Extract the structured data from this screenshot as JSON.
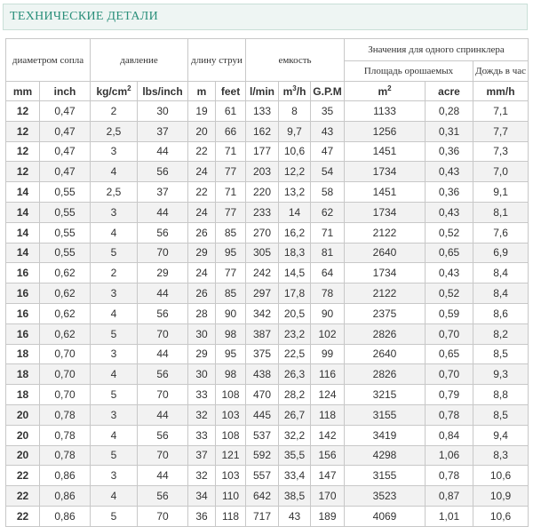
{
  "title": "ТЕХНИЧЕСКИЕ ДЕТАЛИ",
  "groups": {
    "nozzle": "диаметром сопла",
    "pressure": "давление",
    "jet": "длину струи",
    "capacity": "емкость",
    "per_sprinkler": "Значения для одного спринклера",
    "area": "Площадь орошаемых",
    "rain": "Дождь в час"
  },
  "units": [
    "mm",
    "inch",
    "kg/cm",
    "lbs/inch",
    "m",
    "feet",
    "l/min",
    "m",
    "G.P.M",
    "m",
    "acre",
    "mm/h"
  ],
  "unit_sup": {
    "kgcm": "2",
    "m3h_sup": "3",
    "m3h_rest": "/h",
    "m2_sup": "2"
  },
  "rows": [
    [
      "12",
      "0,47",
      "2",
      "30",
      "19",
      "61",
      "133",
      "8",
      "35",
      "1133",
      "0,28",
      "7,1"
    ],
    [
      "12",
      "0,47",
      "2,5",
      "37",
      "20",
      "66",
      "162",
      "9,7",
      "43",
      "1256",
      "0,31",
      "7,7"
    ],
    [
      "12",
      "0,47",
      "3",
      "44",
      "22",
      "71",
      "177",
      "10,6",
      "47",
      "1451",
      "0,36",
      "7,3"
    ],
    [
      "12",
      "0,47",
      "4",
      "56",
      "24",
      "77",
      "203",
      "12,2",
      "54",
      "1734",
      "0,43",
      "7,0"
    ],
    [
      "14",
      "0,55",
      "2,5",
      "37",
      "22",
      "71",
      "220",
      "13,2",
      "58",
      "1451",
      "0,36",
      "9,1"
    ],
    [
      "14",
      "0,55",
      "3",
      "44",
      "24",
      "77",
      "233",
      "14",
      "62",
      "1734",
      "0,43",
      "8,1"
    ],
    [
      "14",
      "0,55",
      "4",
      "56",
      "26",
      "85",
      "270",
      "16,2",
      "71",
      "2122",
      "0,52",
      "7,6"
    ],
    [
      "14",
      "0,55",
      "5",
      "70",
      "29",
      "95",
      "305",
      "18,3",
      "81",
      "2640",
      "0,65",
      "6,9"
    ],
    [
      "16",
      "0,62",
      "2",
      "29",
      "24",
      "77",
      "242",
      "14,5",
      "64",
      "1734",
      "0,43",
      "8,4"
    ],
    [
      "16",
      "0,62",
      "3",
      "44",
      "26",
      "85",
      "297",
      "17,8",
      "78",
      "2122",
      "0,52",
      "8,4"
    ],
    [
      "16",
      "0,62",
      "4",
      "56",
      "28",
      "90",
      "342",
      "20,5",
      "90",
      "2375",
      "0,59",
      "8,6"
    ],
    [
      "16",
      "0,62",
      "5",
      "70",
      "30",
      "98",
      "387",
      "23,2",
      "102",
      "2826",
      "0,70",
      "8,2"
    ],
    [
      "18",
      "0,70",
      "3",
      "44",
      "29",
      "95",
      "375",
      "22,5",
      "99",
      "2640",
      "0,65",
      "8,5"
    ],
    [
      "18",
      "0,70",
      "4",
      "56",
      "30",
      "98",
      "438",
      "26,3",
      "116",
      "2826",
      "0,70",
      "9,3"
    ],
    [
      "18",
      "0,70",
      "5",
      "70",
      "33",
      "108",
      "470",
      "28,2",
      "124",
      "3215",
      "0,79",
      "8,8"
    ],
    [
      "20",
      "0,78",
      "3",
      "44",
      "32",
      "103",
      "445",
      "26,7",
      "118",
      "3155",
      "0,78",
      "8,5"
    ],
    [
      "20",
      "0,78",
      "4",
      "56",
      "33",
      "108",
      "537",
      "32,2",
      "142",
      "3419",
      "0,84",
      "9,4"
    ],
    [
      "20",
      "0,78",
      "5",
      "70",
      "37",
      "121",
      "592",
      "35,5",
      "156",
      "4298",
      "1,06",
      "8,3"
    ],
    [
      "22",
      "0,86",
      "3",
      "44",
      "32",
      "103",
      "557",
      "33,4",
      "147",
      "3155",
      "0,78",
      "10,6"
    ],
    [
      "22",
      "0,86",
      "4",
      "56",
      "34",
      "110",
      "642",
      "38,5",
      "170",
      "3523",
      "0,87",
      "10,9"
    ],
    [
      "22",
      "0,86",
      "5",
      "70",
      "36",
      "118",
      "717",
      "43",
      "189",
      "4069",
      "1,01",
      "10,6"
    ]
  ]
}
